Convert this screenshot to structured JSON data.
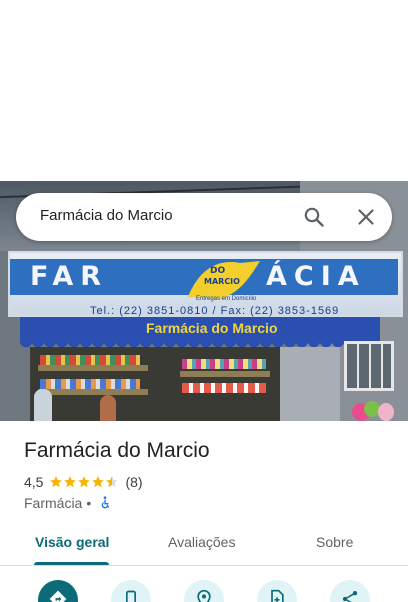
{
  "search": {
    "query": "Farmácia do Marcio"
  },
  "photo": {
    "sign_left": "FAR",
    "sign_right": "ÁCIA",
    "logo_line1": "DO",
    "logo_line2": "MARCIO",
    "sign_sub": "Entregas em Domicílio",
    "sign_phone": "Tel.: (22) 3851-0810 / Fax: (22) 3853-1569",
    "awning_text": "Farmácia do Marcio"
  },
  "place": {
    "title": "Farmácia do Marcio",
    "rating": "4,5",
    "stars": 4.5,
    "reviews": "(8)",
    "category": "Farmácia",
    "separator": "•"
  },
  "tabs": [
    {
      "label": "Visão geral",
      "active": true
    },
    {
      "label": "Avaliações",
      "active": false
    },
    {
      "label": "Sobre",
      "active": false
    }
  ],
  "actions": [
    "directions-icon",
    "phone-icon",
    "save-location-icon",
    "add-document-icon",
    "share-icon"
  ],
  "colors": {
    "accent": "#0b6b78",
    "star": "#f4b400",
    "accessible": "#1a73e8"
  }
}
